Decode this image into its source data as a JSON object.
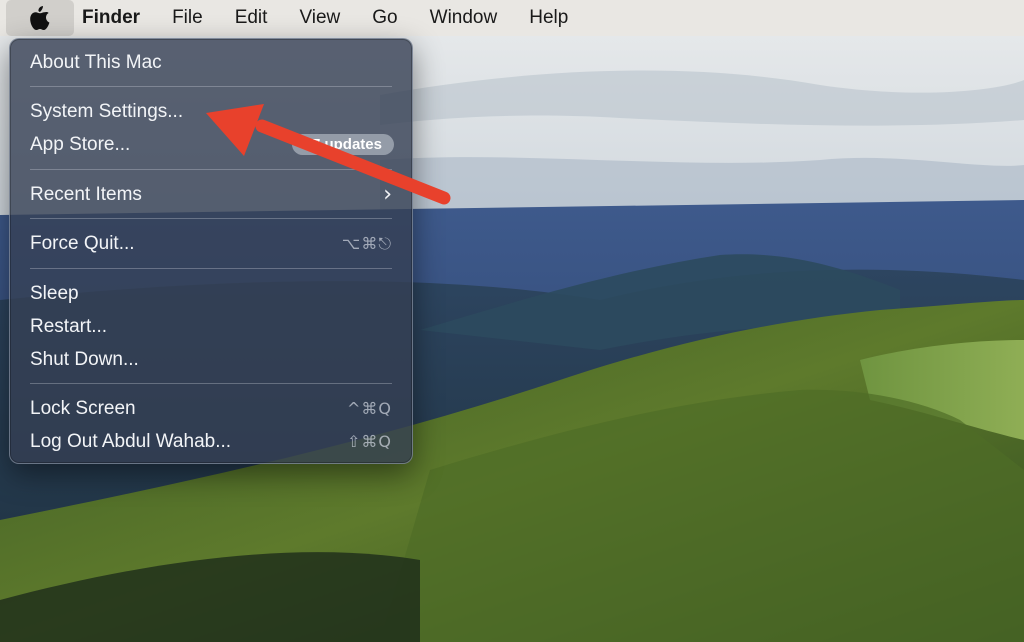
{
  "menubar": {
    "apple_icon": "apple-logo-icon",
    "app_name": "Finder",
    "menus": [
      "File",
      "Edit",
      "View",
      "Go",
      "Window",
      "Help"
    ]
  },
  "apple_menu": {
    "about": "About This Mac",
    "system_settings": "System Settings...",
    "app_store": "App Store...",
    "app_store_badge": "17 updates",
    "recent_items": "Recent Items",
    "recent_items_chevron": "›",
    "force_quit": "Force Quit...",
    "force_quit_shortcut": "⌥⌘⎋",
    "sleep": "Sleep",
    "restart": "Restart...",
    "shut_down": "Shut Down...",
    "lock_screen": "Lock Screen",
    "lock_screen_shortcut": "^⌘Q",
    "log_out": "Log Out Abdul Wahab...",
    "log_out_shortcut": "⇧⌘Q"
  },
  "annotation": {
    "arrow_color": "#e8412c",
    "target": "system_settings"
  }
}
